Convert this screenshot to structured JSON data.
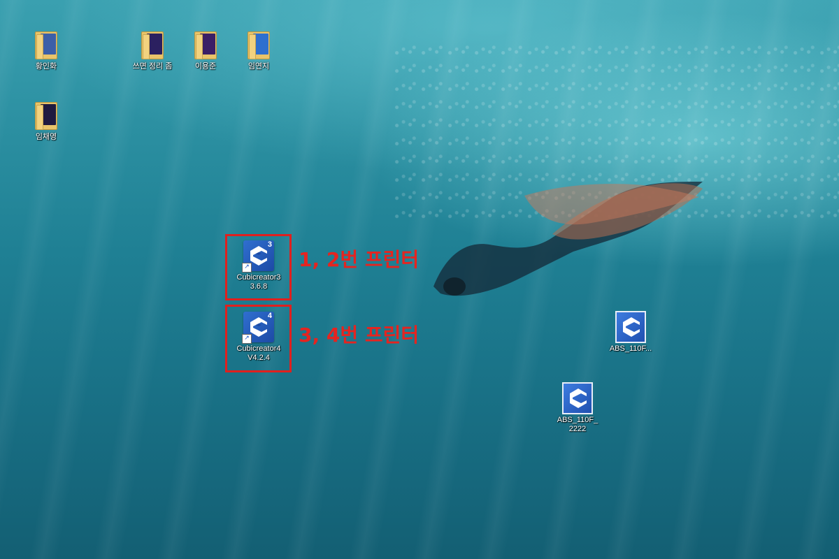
{
  "desktop": {
    "folders": [
      {
        "name": "folder-hwanginhwa",
        "label": "황인화",
        "doc_color": "#3c5fa8"
      },
      {
        "name": "folder-sseumyeon",
        "label": "쓰면 정리 좀",
        "doc_color": "#2b2060"
      },
      {
        "name": "folder-iyongjun",
        "label": "이용준",
        "doc_color": "#3b1f66"
      },
      {
        "name": "folder-imyeonji",
        "label": "임연지",
        "doc_color": "#2e6fcf"
      },
      {
        "name": "folder-imchaeyeong",
        "label": "임채영",
        "doc_color": "#1f1a40"
      }
    ],
    "apps": [
      {
        "label": "Cubicreator3\n3.6.8",
        "version_badge": "3"
      },
      {
        "label": "Cubicreator4\nV4.2.4",
        "version_badge": "4"
      }
    ],
    "files": [
      {
        "label": "ABS_110F..."
      },
      {
        "label": "ABS_110F_\n2222"
      }
    ],
    "annotations": [
      {
        "text": "1, 2번 프린터",
        "color": "#e52420"
      },
      {
        "text": "3, 4번 프린터",
        "color": "#e52420"
      }
    ]
  }
}
